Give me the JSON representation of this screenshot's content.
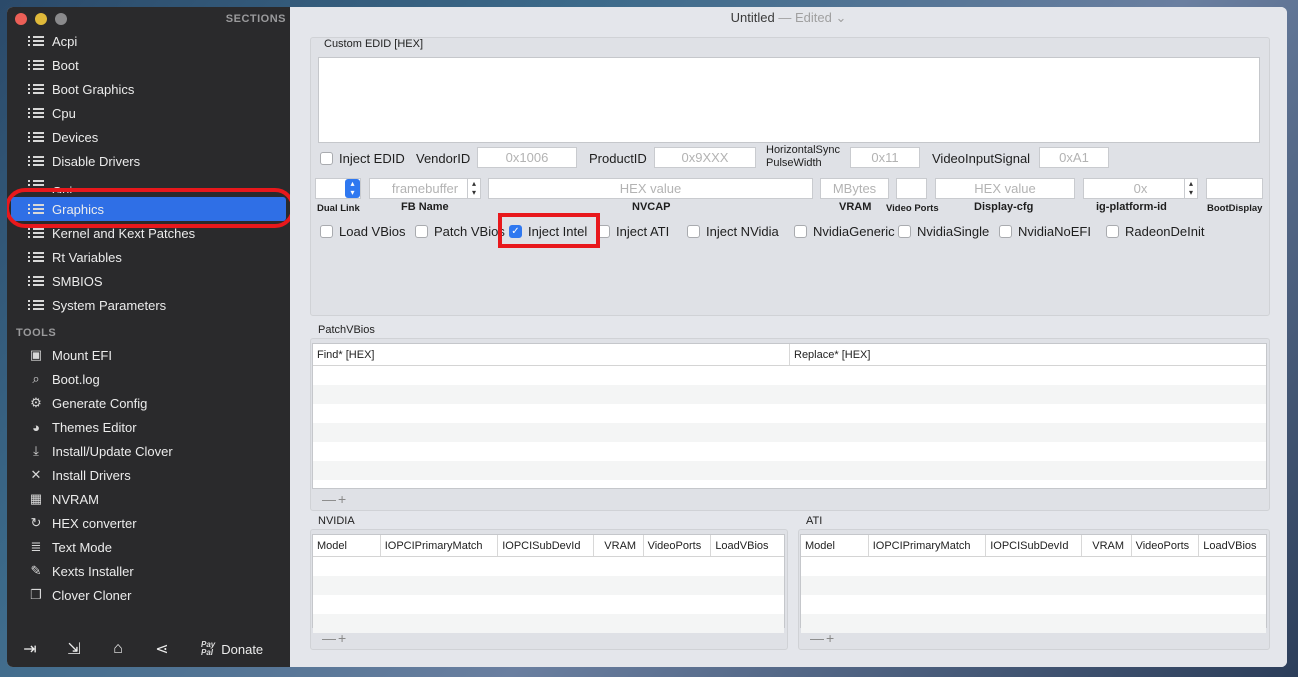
{
  "window": {
    "title": "Untitled",
    "status": "— Edited",
    "status_chevron": "⌄"
  },
  "sidebar": {
    "sections_header": "SECTIONS",
    "sections": [
      {
        "label": "Acpi"
      },
      {
        "label": "Boot"
      },
      {
        "label": "Boot Graphics"
      },
      {
        "label": "Cpu"
      },
      {
        "label": "Devices"
      },
      {
        "label": "Disable Drivers"
      },
      {
        "label": "Gui"
      },
      {
        "label": "Graphics",
        "selected": true
      },
      {
        "label": "Kernel and Kext Patches"
      },
      {
        "label": "Rt Variables"
      },
      {
        "label": "SMBIOS"
      },
      {
        "label": "System Parameters"
      }
    ],
    "tools_header": "TOOLS",
    "tools": [
      {
        "label": "Mount EFI",
        "icon": "drive-icon",
        "glyph": "▣"
      },
      {
        "label": "Boot.log",
        "icon": "log-search-icon",
        "glyph": "⌕"
      },
      {
        "label": "Generate Config",
        "icon": "gears-icon",
        "glyph": "⚙"
      },
      {
        "label": "Themes Editor",
        "icon": "palette-icon",
        "glyph": "◕"
      },
      {
        "label": "Install/Update Clover",
        "icon": "download-icon",
        "glyph": "⤓"
      },
      {
        "label": "Install Drivers",
        "icon": "tools-icon",
        "glyph": "✕"
      },
      {
        "label": "NVRAM",
        "icon": "chip-icon",
        "glyph": "▦"
      },
      {
        "label": "HEX converter",
        "icon": "refresh-icon",
        "glyph": "↻"
      },
      {
        "label": "Text Mode",
        "icon": "text-icon",
        "glyph": "≣"
      },
      {
        "label": "Kexts Installer",
        "icon": "brush-icon",
        "glyph": "✎"
      },
      {
        "label": "Clover Cloner",
        "icon": "clone-icon",
        "glyph": "❐"
      }
    ],
    "bottom": {
      "icons": [
        {
          "name": "import-icon",
          "glyph": "⇥"
        },
        {
          "name": "export-icon",
          "glyph": "⇲"
        },
        {
          "name": "home-icon",
          "glyph": "⌂"
        },
        {
          "name": "share-icon",
          "glyph": "⋖"
        }
      ],
      "paypal_top": "Pay",
      "paypal_bottom": "Pal",
      "donate": "Donate"
    }
  },
  "graphics": {
    "custom_edid_label": "Custom EDID [HEX]",
    "custom_edid_value": "",
    "inject_edid": {
      "label": "Inject EDID",
      "checked": false
    },
    "vendor_id": {
      "label": "VendorID",
      "placeholder": "0x1006"
    },
    "product_id": {
      "label": "ProductID",
      "placeholder": "0x9XXX"
    },
    "hsync": {
      "label_line1": "HorizontalSync",
      "label_line2": "PulseWidth",
      "placeholder": "0x11"
    },
    "video_input_signal": {
      "label": "VideoInputSignal",
      "placeholder": "0xA1"
    },
    "row2": {
      "dual_link": {
        "label": "Dual Link",
        "value": ""
      },
      "fb_name": {
        "label": "FB Name",
        "placeholder": "framebuffer"
      },
      "nvcap": {
        "label": "NVCAP",
        "placeholder": "HEX value"
      },
      "vram": {
        "label": "VRAM",
        "placeholder": "MBytes"
      },
      "video_ports": {
        "label": "Video Ports",
        "placeholder": ""
      },
      "display_cfg": {
        "label": "Display-cfg",
        "placeholder": "HEX value"
      },
      "ig_platform_id": {
        "label": "ig-platform-id",
        "placeholder": "0x"
      },
      "boot_display": {
        "label": "BootDisplay",
        "placeholder": ""
      }
    },
    "checkboxes": [
      {
        "label": "Load VBios",
        "checked": false
      },
      {
        "label": "Patch VBios",
        "checked": false
      },
      {
        "label": "Inject Intel",
        "checked": true
      },
      {
        "label": "Inject ATI",
        "checked": false
      },
      {
        "label": "Inject NVidia",
        "checked": false
      },
      {
        "label": "NvidiaGeneric",
        "checked": false
      },
      {
        "label": "NvidiaSingle",
        "checked": false
      },
      {
        "label": "NvidiaNoEFI",
        "checked": false
      },
      {
        "label": "RadeonDeInit",
        "checked": false
      }
    ],
    "checkmark": "✓"
  },
  "patch_vbios": {
    "label": "PatchVBios",
    "columns": [
      "Find* [HEX]",
      "Replace* [HEX]"
    ],
    "minus": "—",
    "plus": "+"
  },
  "nvidia": {
    "label": "NVIDIA",
    "columns": [
      "Model",
      "IOPCIPrimaryMatch",
      "IOPCISubDevId",
      "VRAM",
      "VideoPorts",
      "LoadVBios"
    ]
  },
  "ati": {
    "label": "ATI",
    "columns": [
      "Model",
      "IOPCIPrimaryMatch",
      "IOPCISubDevId",
      "VRAM",
      "VideoPorts",
      "LoadVBios"
    ]
  }
}
